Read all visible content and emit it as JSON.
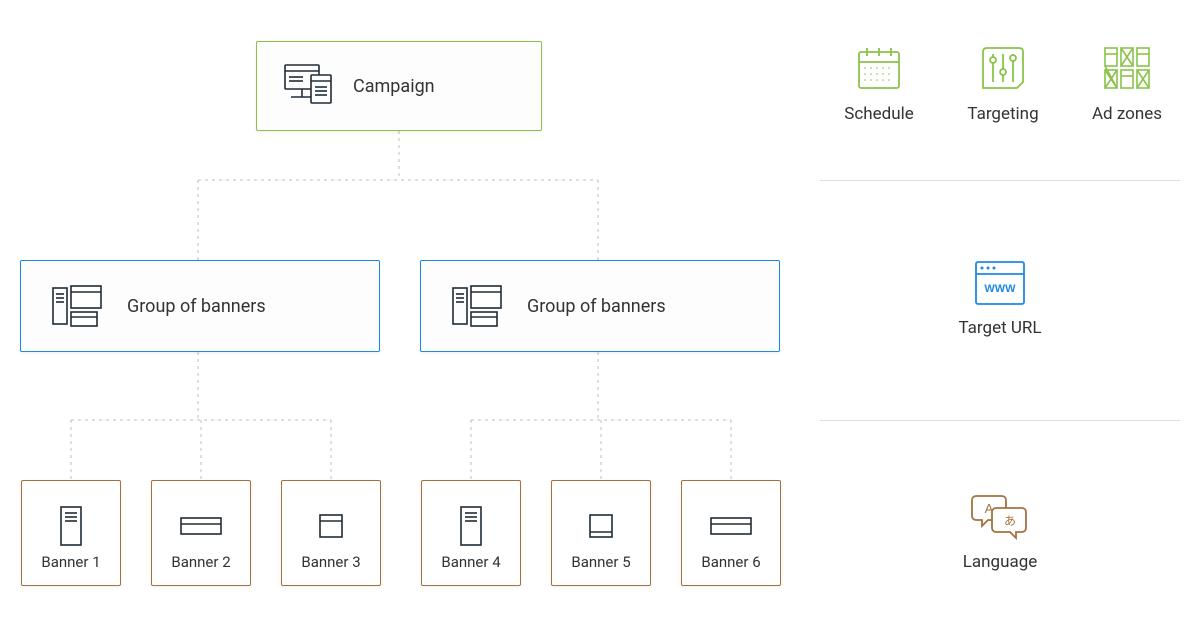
{
  "hierarchy": {
    "campaign": {
      "label": "Campaign"
    },
    "groups": [
      {
        "label": "Group of banners"
      },
      {
        "label": "Group of banners"
      }
    ],
    "banners": [
      {
        "label": "Banner 1"
      },
      {
        "label": "Banner 2"
      },
      {
        "label": "Banner 3"
      },
      {
        "label": "Banner 4"
      },
      {
        "label": "Banner 5"
      },
      {
        "label": "Banner 6"
      }
    ]
  },
  "sidebar": {
    "row1": [
      {
        "label": "Schedule"
      },
      {
        "label": "Targeting"
      },
      {
        "label": "Ad zones"
      }
    ],
    "row2": {
      "label": "Target URL"
    },
    "row3": {
      "label": "Language"
    }
  },
  "colors": {
    "green": "#8bc34a",
    "blue": "#1e88e5",
    "brown": "#a5713e",
    "iconStroke": "#212b36"
  }
}
